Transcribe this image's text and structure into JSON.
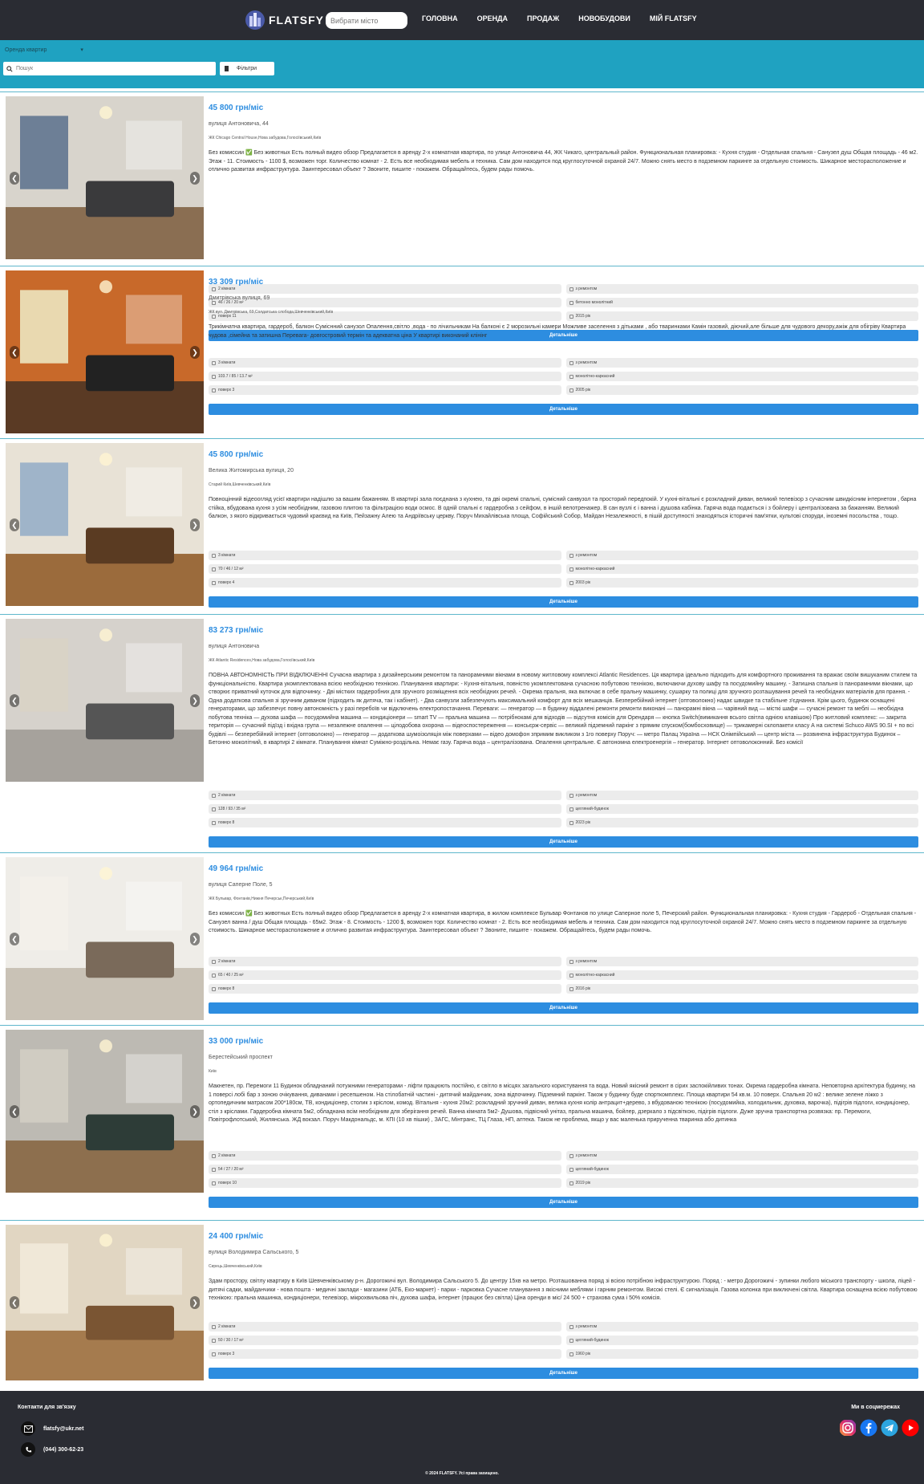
{
  "header": {
    "logo_text": "FLATSFY",
    "city_placeholder": "Вибрати місто",
    "nav": [
      "ГОЛОВНА",
      "ОРЕНДА",
      "ПРОДАЖ",
      "НОВОБУДОВИ",
      "МІЙ FLATSFY"
    ]
  },
  "filters": {
    "rent_select": "Оренда квартир",
    "search_placeholder": "Пошук",
    "filters_label": "Фільтри"
  },
  "listings": [
    {
      "price": "45 800 грн/міс",
      "address": "вулиця Антоновича, 44",
      "area": "ЖК Chicago Central House,Нова забудова,Голосіївський,Київ",
      "description": "Без комиссии ✅ Без животных Есть полный видео обзор Предлагается в аренду 2-х комнатная квартира, по улице Антоновича 44, ЖК Чикаго, центральный район. Функциональная планировка: - Кухня студия - Отдельная спальня - Санузел душ Общая площадь - 46 м2. Этаж - 11. Стоимость - 1100 $, возможен торг. Количество комнат - 2. Есть все необходимая мебель и техника. Сам дом находится под круглосуточной охраной 24/7. Можно снять место в подземном паркинге за отдельную стоимость. Шикарное месторасположение и отлично развитая инфраструктура. Заинтересовал объект ? Звоните, пишите - покажем. Обращайтесь, будем рады помочь.",
      "rooms": "2 кімнати",
      "repair": "з ремонтом",
      "sizes": "46 / 26 / 20 м²",
      "material": "бетонно монолітний",
      "floor": "поверх 11",
      "year": "2015 рік",
      "button": "Детальніше"
    },
    {
      "price": "33 309 грн/міс",
      "address": "Дмитрівська вулиця, 69",
      "area": "ЖК вул. Дмитрівська, 69,Солдатська слобода,Шевченківський,Київ",
      "description": "Трикімнатна квартира, гардероб, балкон Суміснний санузол Опалення,світло ,вода - по лічильникам На балконі є 2 морозильні камери Можливе заселення з дітьками , або тваринками Камін газовий, діючий,але більше для чудового декору,ажіж для обігріву Квартира чудова ,сімейна та затишна Перевага- довгостровий термін та адекватна ціна У квартирі виконаний клінінг",
      "rooms": "3 кімнати",
      "repair": "з ремонтом",
      "sizes": "103.7 / 85 / 13.7 м²",
      "material": "монолітно-каркасний",
      "floor": "поверх 3",
      "year": "2005 рік",
      "button": "Детальніше"
    },
    {
      "price": "45 800 грн/міс",
      "address": "Велика Житомирська вулиця, 20",
      "area": "Старий Київ,Шевченківський,Київ",
      "description": "Повноцінний відеоогляд усієї квартири надішлю за вашим бажанням. В квартирі зала поєднана з кухнею, та дві окремі спальні, сумісний санвузол та просторий передпокій. У кухні-вітальні є розкладний диван, великий телевізор з сучасним швидкісним інтернетом , барна стійка, вбудована кухня з усім необхідним, газовою плитою та фільтрацією води осмос. В одній спальні є гардеробна з сейфом, в іншій велотренажер. В сан вузлі є і ванна і душова кабінка. Гаряча вода подається і з бойлеру і централізована за бажанням. Великий балкон, з якого відкривається чудовий краєвид на Київ, Пейзажну Алею та Андріївську церкву. Поруч Михайлівська площа, Софійський Собор, Майдан Незалежності, в пішій доступності знаходяться історичні пам'ятки, культові споруди, іноземні посольства , тощо.",
      "rooms": "3 кімнати",
      "repair": "з ремонтом",
      "sizes": "70 / 46 / 12 м²",
      "material": "монолітно-каркасний",
      "floor": "поверх 4",
      "year": "2003 рік",
      "button": "Детальніше"
    },
    {
      "price": "83 273 грн/міс",
      "address": "вулиця Антоновича",
      "area": "ЖК Atlantic Residences,Нова забудова,Голосіївський,Київ",
      "description": "ПОВНА АВТОНОМНІСТЬ ПРИ ВІДКЛЮЧЕННІ Сучасна квартира з дизайнерським ремонтом та панорамними вікнами в новому житловому комплексі Atlantic Residences. Ця квартира ідеально підходить для комфортного проживання та вражає своїм вишуканим стилем та функціональністю. Квартира укомплектована всією необхідною технікою. Планування квартири: - Кухня-вітальня, повністю укомплектована сучасною побутовою технікою, включаючи духову шафу та посудомийну машину. - Затишна спальня із панорамними вікнами, що створює приватний куточок для відпочинку. - Дві містких гардеробних для зручного розміщення всіх необхідних речей. - Окрема пральня, яка включає в себе пральну машинку, сушарку та полиці для зручного розташування речей та необхідних матеріалів для прання. - Одна додаткова спальня зі зручним диваном (підходить як дитяча, так і кабінет). - Два санвузли забезпечують максимальний комфорт для всіх мешканців. Безперебійний інтернет (оптоволокно) надає швидке та стабільне з'єднання. Крім цього, будинок оснащені генераторами, що забезпечує повну автономність у разі перебоїв чи відключень електропостачання. Переваги: — генератор — в будинку віддалені ремонти ремонти виконані — панорамні вікна — чарівний вид — місткі шафи — сучасні ремонт та меблі — необхідна побутова техніка — духова шафа — посудомийна машина — кондиціонери — smart TV — пральна машина — потрібнокамі для відходів — відсутня комісія для Орендаря — кнопка Switch(вимикання всього світла однією клавішою) Про житловий комплекс: — закрита територія — сучасний підїзд і вхідна група — незалежне опалення — цілодобова охорона — відеоспостереження — консьєрж-сервіс — великий підземний паркінг з прямим спуском(бомбосховище) — трикамерні склопакети класу А на системі Schuco AWS 90.SI + по всі будівлі — безперебійний інтернет (оптоволокно) — генератор — додаткова шумоізоляція між поверхами — відео домофон зпримим викликом з 1го поверху Поруч: — метро Палац Україна — НСК Олімпійський — центр міста — розвинена інфраструктура Будинок – Бетонно моколітний, в квартирі 2 кімнати. Планування кімнат Суміжно-роздільна. Немає газу. Гаряча вода – централізована. Опалення центральне. Є автономна електроенергія – генератор. Інтернет оптоволоконний. Без комісії",
      "rooms": "2 кімнати",
      "repair": "з ремонтом",
      "sizes": "128 / 93 / 35 м²",
      "material": "цегляний-будинок",
      "floor": "поверх 8",
      "year": "2023 рік",
      "button": "Детальніше"
    },
    {
      "price": "49 964 грн/міс",
      "address": "вулиця Саперне Поле, 5",
      "area": "ЖК Бульвар, Фонтанів,Нижня Печерськ,Печерський,Київ",
      "description": "Без комиссии ✅ Без животных Есть полный видео обзор Предлагается в аренду 2-х комнатная квартира, в жилом комплексе Бульвар Фонтанов по улице Саперное поле 5, Печерский район. Функциональная планировка: - Кухня студия - Гардероб - Отдельная спальня - Санузел ванна / душ Общая площадь - 65м2. Этаж - 8. Стоимость - 1200 $, возможен торг. Количество комнат - 2. Есть все необходимая мебель и техника. Сам дом находится под круглосуточной охраной 24/7. Можно снять место в подземном паркинге за отдельную стоимость. Шикарное месторасположение и отлично развитая инфраструктура. Заинтересовал объект ? Звоните, пишите - покажем. Обращайтесь, будем рады помочь.",
      "rooms": "2 кімнати",
      "repair": "з ремонтом",
      "sizes": "65 / 40 / 25 м²",
      "material": "монолітно-каркасний",
      "floor": "поверх 8",
      "year": "2016 рік",
      "button": "Детальніше"
    },
    {
      "price": "33 000 грн/міс",
      "address": "Берестейський проспект",
      "area": "Київ",
      "description": "Макнетен, пр. Перемоги 11 Будинок обладнаний потужними генераторами - ліфти працюють постійно, є світло в місцях загального користування та вода. Новий якісний ремонт в сірих заспокійливих тонах. Окрема гардеробна кімната. Неповторна архітектура будинку, на 1 поверсі лобі бар з зоною очікування, диванами і ресепшеном. На стілобатній частині - дитячий майданчик, зона відпочинку. Підземний паркінг. Також у будинку буде спорткомплекс. Площа квартири 54 кв.м. 10 поверх. Спальня 20 м2 : велике зелене ліжко з ортопедичним матрасом 200*180см, ТВ, кондиціонер, столик з кріслом, комод. Вітальня - кухня 20м2: розкладний зручний диван, велика кухня колір антрацит+дерево, з вбудованою технікою (посудомийка, холодильник, духовка, варочка), підігрів підлоги, кондиціонер, стіл з кріслами. Гардеробна кімната 5м2, обладнана всім необхідним для зберігання речей. Ванна кімната 5м2- Душова, підвісний унітаз, пральна машина, бойлер, дзеркало з підсвіткою, підігрів підлоги. Дуже зручна транспортна розвязка: пр. Перемоги, Повітрофлотський, Жилянська. ЖД вокзал. Поруч Макдональдс, м. КПІ (10 хв пішки) , ЗАГС, Мінтранс, ТЦ Глаза, НП, аптека. Також не проблема, якщо у вас маленька прирученна тваринка або дитинка",
      "rooms": "2 кімнати",
      "repair": "з ремонтом",
      "sizes": "54 / 27 / 20 м²",
      "material": "цегляний-будинок",
      "floor": "поверх 10",
      "year": "2019 рік",
      "button": "Детальніше"
    },
    {
      "price": "24 400 грн/міс",
      "address": "вулиця Володимира Сальського, 5",
      "area": "Сирець,Шевченківський,Київ",
      "description": "Здам простору, світлу квартиру в Київ Шевченківському р-н. Дорогожичі вул. Володимира Сальського 5. До центру 15хв на метро. Розташованна поряд зі всією потрібною інфраструктурою. Поряд : - метро Дорогожичі - зупинки любого міського транспорту - школа, ліцей - дитячі садки, майданчики - нова пошта - медичні заклади - магазини (АТБ, Еко-маркет) - парки - парковка Сучасне планування з якісними меблями і гарним ремонтом. Високі стелі. Є сигналізація. Газова колонка при виключені світла. Квартира оснащена всією побутовою технікою: пральна машинка, кондиціонери, телевізор, мікрохвильова піч, духова шафа, інтернет (працює без світла) Ціна оренди в міс/ 24 500 + страхова сума і 50% комісія.",
      "rooms": "2 кімнати",
      "repair": "з ремонтом",
      "sizes": "50 / 30 / 17 м²",
      "material": "цегляний-будинок",
      "floor": "поверх 3",
      "year": "1960 рік",
      "button": "Детальніше"
    }
  ],
  "footer": {
    "contacts_title": "Контакти для зв'язку",
    "email": "flatsfy@ukr.net",
    "phone": "(044) 300-62-23",
    "social_title": "Ми в соцмережах",
    "copyright": "© 2024 FLATSFY. Усі права захищено."
  },
  "colors": {
    "header_bg": "#2a2c33",
    "filter_bg": "#1fa2c1",
    "accent": "#2d8de0"
  }
}
